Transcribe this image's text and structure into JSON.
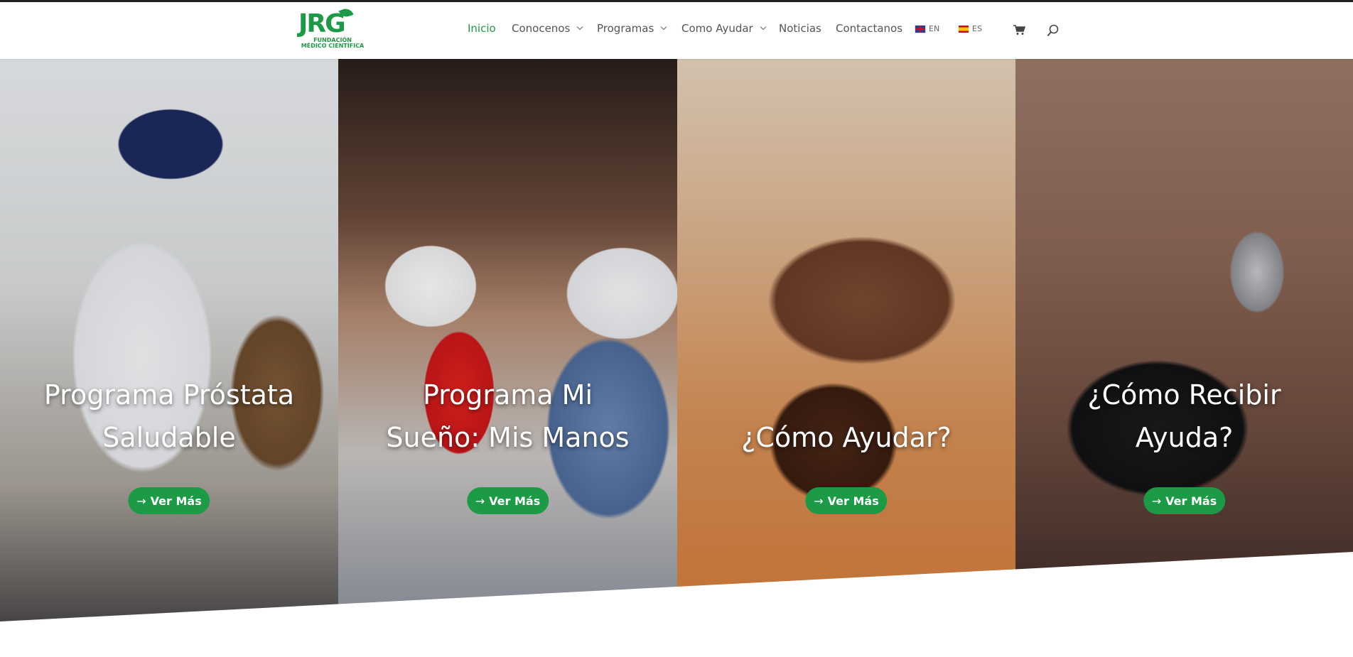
{
  "brand": {
    "logo_mark": "JRG",
    "logo_sub": "FUNDACIÓN MÉDICO CIENTÍFICA",
    "color": "#1d9a46"
  },
  "nav": {
    "items": [
      {
        "label": "Inicio",
        "active": true,
        "dropdown": false
      },
      {
        "label": "Conocenos",
        "active": false,
        "dropdown": true
      },
      {
        "label": "Programas",
        "active": false,
        "dropdown": true
      },
      {
        "label": "Como Ayudar",
        "active": false,
        "dropdown": true
      },
      {
        "label": "Noticias",
        "active": false,
        "dropdown": false
      },
      {
        "label": "Contactanos",
        "active": false,
        "dropdown": false
      }
    ],
    "languages": [
      {
        "code": "EN",
        "flag": "uk-flag-icon"
      },
      {
        "code": "ES",
        "flag": "spain-flag-icon"
      }
    ],
    "icons": [
      "cart-icon",
      "search-icon"
    ]
  },
  "hero": {
    "panels": [
      {
        "title_line1": "Programa Próstata",
        "title_line2": "Saludable",
        "button": "Ver Más"
      },
      {
        "title_line1": "Programa Mi",
        "title_line2": "Sueño: Mis Manos",
        "button": "Ver Más"
      },
      {
        "title_line1": "",
        "title_line2": "¿Cómo Ayudar?",
        "button": "Ver Más"
      },
      {
        "title_line1": "¿Cómo Recibir",
        "title_line2": "Ayuda?",
        "button": "Ver Más"
      }
    ]
  }
}
